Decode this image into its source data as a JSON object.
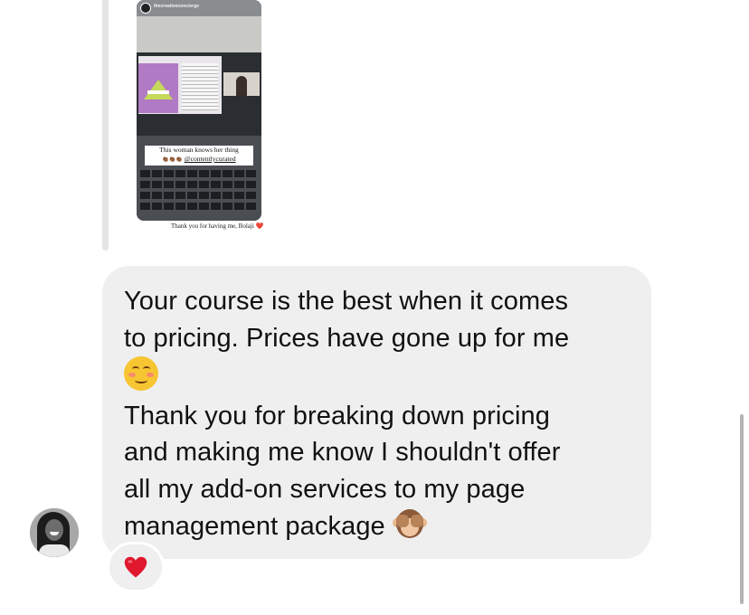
{
  "story_reply": {
    "story_username": "thecreativeconcierge",
    "caption_line1": "This woman knows her thing",
    "caption_emojis": "👏🏾👏🏾👏🏾",
    "caption_handle": "@contentlycurated",
    "reply_text": "Thank you for having me, Bolaji",
    "reply_heart": "❤️"
  },
  "message": {
    "lines": [
      "Your course is the best when it comes",
      "to pricing. Prices have gone up for me",
      "",
      "Thank you for breaking down pricing",
      "and making me know I shouldn't offer",
      "all my add-on services to my page",
      "management package"
    ],
    "emoji_1": "smiling-face-with-blush",
    "emoji_2": "see-no-evil-monkey"
  },
  "reaction": {
    "emoji": "red-heart",
    "color": "#e0182d"
  },
  "colors": {
    "bubble": "#efefef",
    "reply_bar": "#e4e4e6",
    "text": "#111111"
  }
}
